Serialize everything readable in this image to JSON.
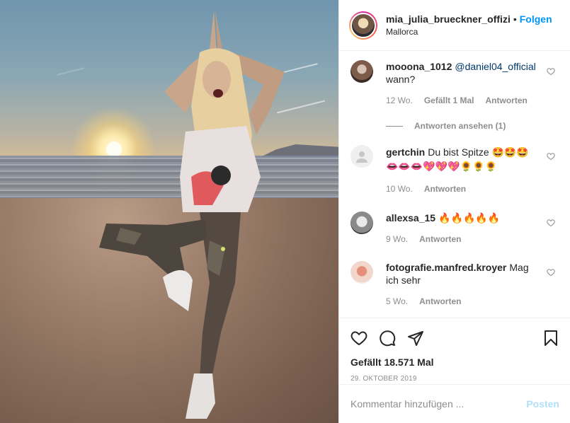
{
  "post": {
    "username": "mia_julia_brueckner_offizi",
    "separator": "•",
    "follow_label": "Folgen",
    "location": "Mallorca"
  },
  "comments": [
    {
      "username": "mooona_1012",
      "mention": "@daniel04_official",
      "text": "wann?",
      "age": "12 Wo.",
      "likes": "Gefällt 1 Mal",
      "reply_label": "Antworten",
      "view_replies": "Antworten ansehen (1)"
    },
    {
      "username": "gertchin",
      "text": "Du bist Spitze 🤩🤩🤩 👄👄👄💖💖💖🌻🌻🌻",
      "age": "10 Wo.",
      "reply_label": "Antworten"
    },
    {
      "username": "allexsa_15",
      "text": "🔥🔥🔥🔥🔥",
      "age": "9 Wo.",
      "reply_label": "Antworten"
    },
    {
      "username": "fotografie.manfred.kroyer",
      "text": "Mag ich sehr",
      "age": "5 Wo.",
      "reply_label": "Antworten"
    }
  ],
  "stats": {
    "likes": "Gefällt 18.571 Mal",
    "date": "29. OKTOBER 2019"
  },
  "compose": {
    "placeholder": "Kommentar hinzufügen ...",
    "post_label": "Posten"
  },
  "colors": {
    "accent": "#0095f6",
    "post_disabled": "#b2dffc",
    "muted": "#8e8e8e",
    "mention": "#00376b"
  },
  "icons": [
    "heart-icon",
    "comment-icon",
    "share-icon",
    "bookmark-icon"
  ]
}
